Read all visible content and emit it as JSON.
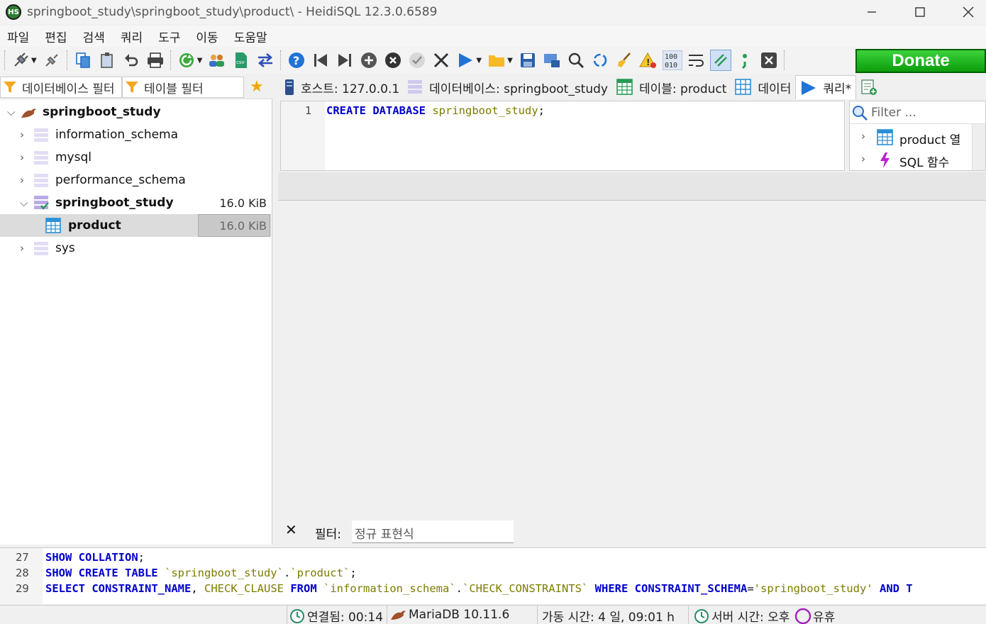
{
  "window": {
    "title": "springboot_study\\springboot_study\\product\\ - HeidiSQL 12.3.0.6589",
    "app_icon_label": "HS"
  },
  "menu": [
    "파일",
    "편집",
    "검색",
    "쿼리",
    "도구",
    "이동",
    "도움말"
  ],
  "toolbar": {
    "donate_label": "Donate"
  },
  "left_panel": {
    "db_filter_placeholder": "데이터베이스 필터",
    "table_filter_placeholder": "테이블 필터",
    "tree": {
      "root": "springboot_study",
      "databases": [
        {
          "name": "information_schema",
          "size": ""
        },
        {
          "name": "mysql",
          "size": ""
        },
        {
          "name": "performance_schema",
          "size": ""
        },
        {
          "name": "springboot_study",
          "size": "16.0 KiB"
        },
        {
          "name": "sys",
          "size": ""
        }
      ],
      "tables": [
        {
          "name": "product",
          "size": "16.0 KiB"
        }
      ]
    }
  },
  "tabs": [
    {
      "label": "호스트: 127.0.0.1"
    },
    {
      "label": "데이터베이스: springboot_study"
    },
    {
      "label": "테이블: product"
    },
    {
      "label": "데이터"
    },
    {
      "label": "쿼리*"
    }
  ],
  "editor": {
    "line_number": "1",
    "kw1": "CREATE",
    "kw2": "DATABASE",
    "ident": "springboot_study",
    "semi": ";"
  },
  "helper": {
    "filter_placeholder": "Filter ...",
    "items": [
      {
        "label": "product 열"
      },
      {
        "label": "SQL 함수"
      }
    ]
  },
  "filter_bar": {
    "label": "필터:",
    "placeholder": "정규 표현식"
  },
  "log": {
    "lines": [
      {
        "num": "27"
      },
      {
        "num": "28"
      },
      {
        "num": "29"
      }
    ],
    "l27_kw": "SHOW COLLATION",
    "l27_end": ";",
    "l28_kw": "SHOW CREATE TABLE",
    "l28_ident": "`springboot_study`",
    "l28_dot": ".",
    "l28_ident2": "`product`",
    "l28_end": ";",
    "l29_kw1": "SELECT",
    "l29_col": "CONSTRAINT_NAME",
    "l29_comma": ",",
    "l29_col2": "CHECK_CLAUSE",
    "l29_kw2": "FROM",
    "l29_ident": "`information_schema`",
    "l29_dot": ".",
    "l29_ident2": "`CHECK_CONSTRAINTS`",
    "l29_kw3": "WHERE",
    "l29_col3": "CONSTRAINT_SCHEMA",
    "l29_eq": "=",
    "l29_str": "'springboot_study'",
    "l29_kw4": "AND T"
  },
  "status": {
    "connected": "연결됨: 00:14",
    "server": "MariaDB 10.11.6",
    "uptime": "가동 시간: 4 일, 09:01 h",
    "server_time": "서버 시간: 오후",
    "idle": "유휴"
  },
  "colors": {
    "accent_green": "#0c9d0c",
    "keyword_blue": "#0000cc",
    "identifier_olive": "#7d7d00"
  }
}
